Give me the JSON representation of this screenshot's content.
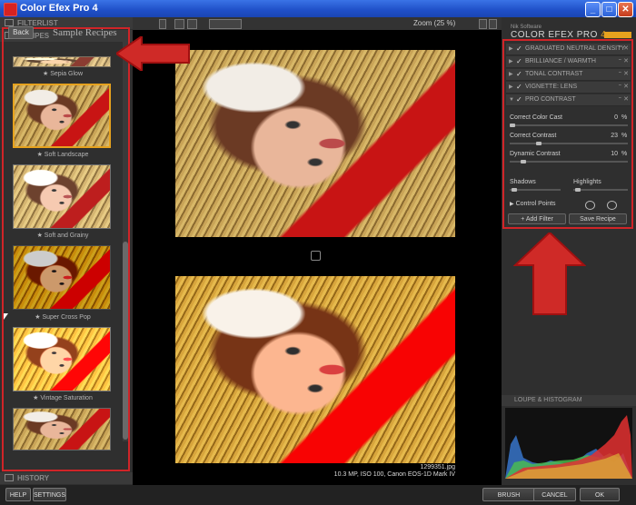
{
  "window": {
    "title": "Color Efex Pro 4",
    "minimize": "_",
    "maximize": "□",
    "close": "✕"
  },
  "left_panel": {
    "filterlist": "FILTERLIST",
    "recipes": "RECIPES",
    "back": "Back",
    "recipes_title": "Sample Recipes",
    "history": "HISTORY",
    "items": [
      {
        "label": "★ Sepia Glow"
      },
      {
        "label": "★ Soft Landscape"
      },
      {
        "label": "★ Soft and Grainy"
      },
      {
        "label": "★ Super Cross Pop"
      },
      {
        "label": "★ Vintage Saturation"
      }
    ]
  },
  "toolbar": {
    "zoom": "Zoom (25 %)"
  },
  "image": {
    "filename": "1299351.jpg",
    "info": "10.3 MP, ISO 100, Canon EOS-1D Mark IV"
  },
  "right_panel": {
    "brand_small": "Nik Software",
    "brand": "COLOR EFEX PRO",
    "brand_version": "4",
    "filters": [
      {
        "name": "GRADUATED NEUTRAL DENSITY",
        "checked": "✓"
      },
      {
        "name": "BRILLIANCE / WARMTH",
        "checked": "✓"
      },
      {
        "name": "TONAL CONTRAST",
        "checked": "✓"
      },
      {
        "name": "VIGNETTE: LENS",
        "checked": "✓"
      },
      {
        "name": "PRO CONTRAST",
        "checked": "✓"
      }
    ],
    "sliders": [
      {
        "label": "Correct Color Cast",
        "value": "0",
        "unit": "%",
        "level": 0.0
      },
      {
        "label": "Correct Contrast",
        "value": "23",
        "unit": "%",
        "level": 0.23
      },
      {
        "label": "Dynamic Contrast",
        "value": "10",
        "unit": "%",
        "level": 0.1
      }
    ],
    "shadows": "Shadows",
    "highlights": "Highlights",
    "control_points": "Control Points",
    "add_filter": "+ Add Filter",
    "save_recipe": "Save Recipe",
    "loupe": "LOUPE & HISTOGRAM"
  },
  "bottom_bar": {
    "help": "HELP",
    "settings": "SETTINGS",
    "brush": "BRUSH",
    "cancel": "CANCEL",
    "ok": "OK"
  },
  "colors": {
    "highlight": "#d02428",
    "accent": "#e6a21e"
  }
}
